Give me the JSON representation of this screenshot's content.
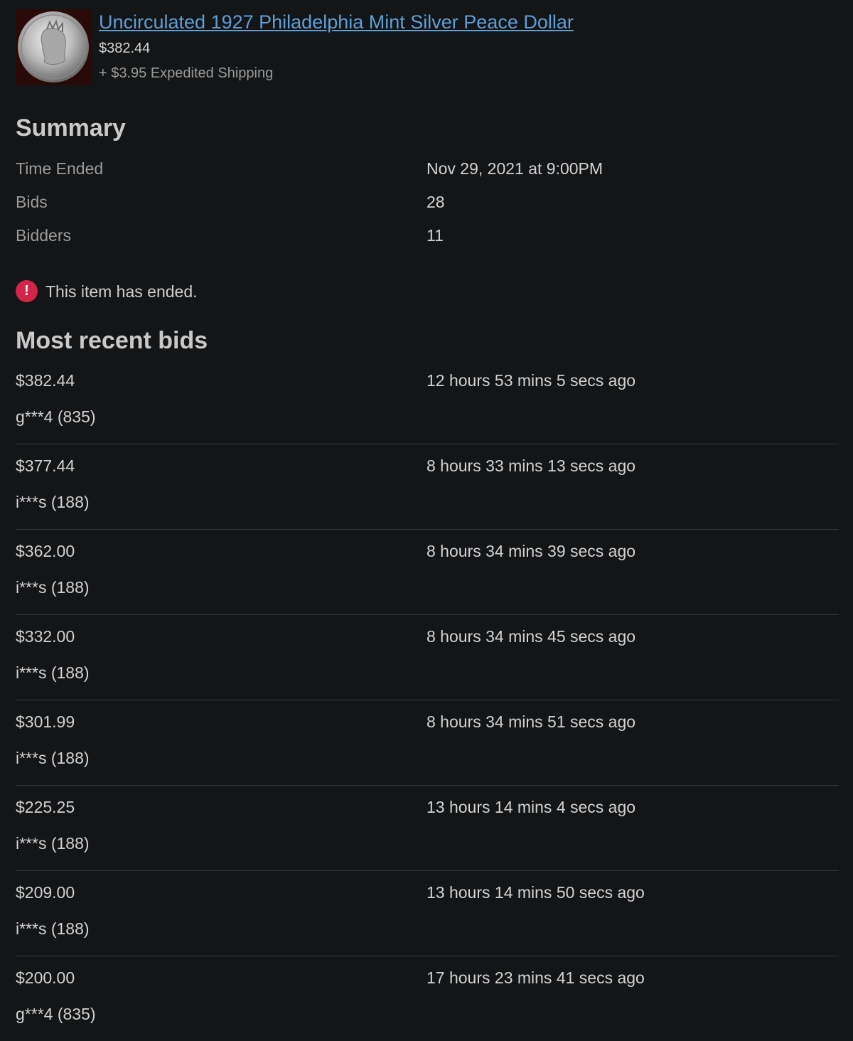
{
  "item": {
    "title": "Uncirculated 1927 Philadelphia Mint Silver Peace Dollar",
    "price": "$382.44",
    "shipping": "+ $3.95 Expedited Shipping",
    "thumbnail_icon": "coin-image"
  },
  "summary": {
    "heading": "Summary",
    "rows": [
      {
        "label": "Time Ended",
        "value": "Nov 29, 2021 at 9:00PM"
      },
      {
        "label": "Bids",
        "value": "28"
      },
      {
        "label": "Bidders",
        "value": "11"
      }
    ]
  },
  "notice": {
    "icon": "alert-icon",
    "icon_glyph": "!",
    "text": "This item has ended."
  },
  "bids": {
    "heading": "Most recent bids",
    "items": [
      {
        "amount": "$382.44",
        "time": "12 hours 53 mins 5 secs ago",
        "user": "g***4 (835)"
      },
      {
        "amount": "$377.44",
        "time": "8 hours 33 mins 13 secs ago",
        "user": "i***s (188)"
      },
      {
        "amount": "$362.00",
        "time": "8 hours 34 mins 39 secs ago",
        "user": "i***s (188)"
      },
      {
        "amount": "$332.00",
        "time": "8 hours 34 mins 45 secs ago",
        "user": "i***s (188)"
      },
      {
        "amount": "$301.99",
        "time": "8 hours 34 mins 51 secs ago",
        "user": "i***s (188)"
      },
      {
        "amount": "$225.25",
        "time": "13 hours 14 mins 4 secs ago",
        "user": "i***s (188)"
      },
      {
        "amount": "$209.00",
        "time": "13 hours 14 mins 50 secs ago",
        "user": "i***s (188)"
      },
      {
        "amount": "$200.00",
        "time": "17 hours 23 mins 41 secs ago",
        "user": "g***4 (835)"
      }
    ]
  },
  "colors": {
    "background": "#141517",
    "link": "#5e9fd6",
    "alert": "#d1264a"
  }
}
